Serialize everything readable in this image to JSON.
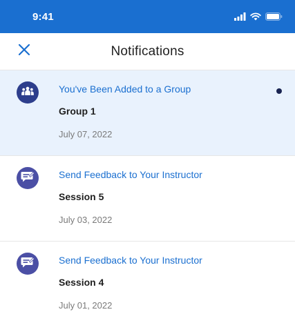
{
  "status_bar": {
    "time": "9:41",
    "icons": [
      "signal-icon",
      "wifi-icon",
      "battery-icon"
    ]
  },
  "header": {
    "title": "Notifications",
    "close_icon": "close-icon"
  },
  "notifications": [
    {
      "icon": "group-icon",
      "title": "You've Been Added to a Group",
      "subtitle": "Group 1",
      "date": "July 07, 2022",
      "unread": true
    },
    {
      "icon": "feedback-icon",
      "title": "Send Feedback to Your Instructor",
      "subtitle": "Session 5",
      "date": "July 03, 2022",
      "unread": false
    },
    {
      "icon": "feedback-icon",
      "title": "Send Feedback to Your Instructor",
      "subtitle": "Session 4",
      "date": "July 01, 2022",
      "unread": false
    }
  ],
  "colors": {
    "status_bar": "#1a6fd0",
    "accent": "#1a6fd0",
    "unread_background": "#e9f2fd",
    "group_avatar": "#2d3e8c",
    "feedback_avatar": "#4b4fa5",
    "unread_dot": "#1a2452"
  }
}
